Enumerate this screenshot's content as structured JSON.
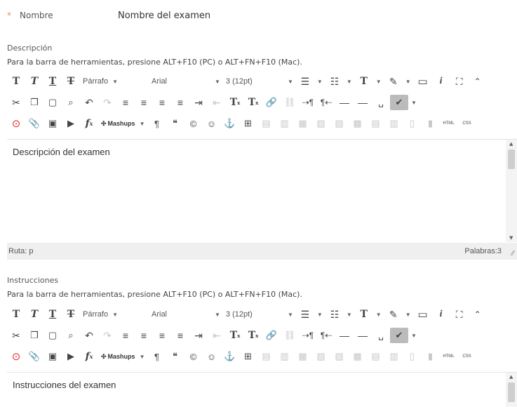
{
  "name_field": {
    "required_mark": "*",
    "label": "Nombre",
    "value": "Nombre del examen"
  },
  "description": {
    "label": "Descripción",
    "hint": "Para la barra de herramientas, presione ALT+F10 (PC) o ALT+FN+F10 (Mac).",
    "toolbar": {
      "paragraph": "Párrafo",
      "font": "Arial",
      "size": "3 (12pt)",
      "mashups": "Mashups",
      "html": "HTML",
      "css": "CSS"
    },
    "content": "Descripción del examen",
    "status_path": "Ruta: p",
    "word_count": "Palabras:3"
  },
  "instructions": {
    "label": "Instrucciones",
    "hint": "Para la barra de herramientas, presione ALT+F10 (PC) o ALT+FN+F10 (Mac).",
    "toolbar": {
      "paragraph": "Párrafo",
      "font": "Arial",
      "size": "3 (12pt)",
      "mashups": "Mashups",
      "html": "HTML",
      "css": "CSS"
    },
    "content": "Instrucciones del examen"
  }
}
